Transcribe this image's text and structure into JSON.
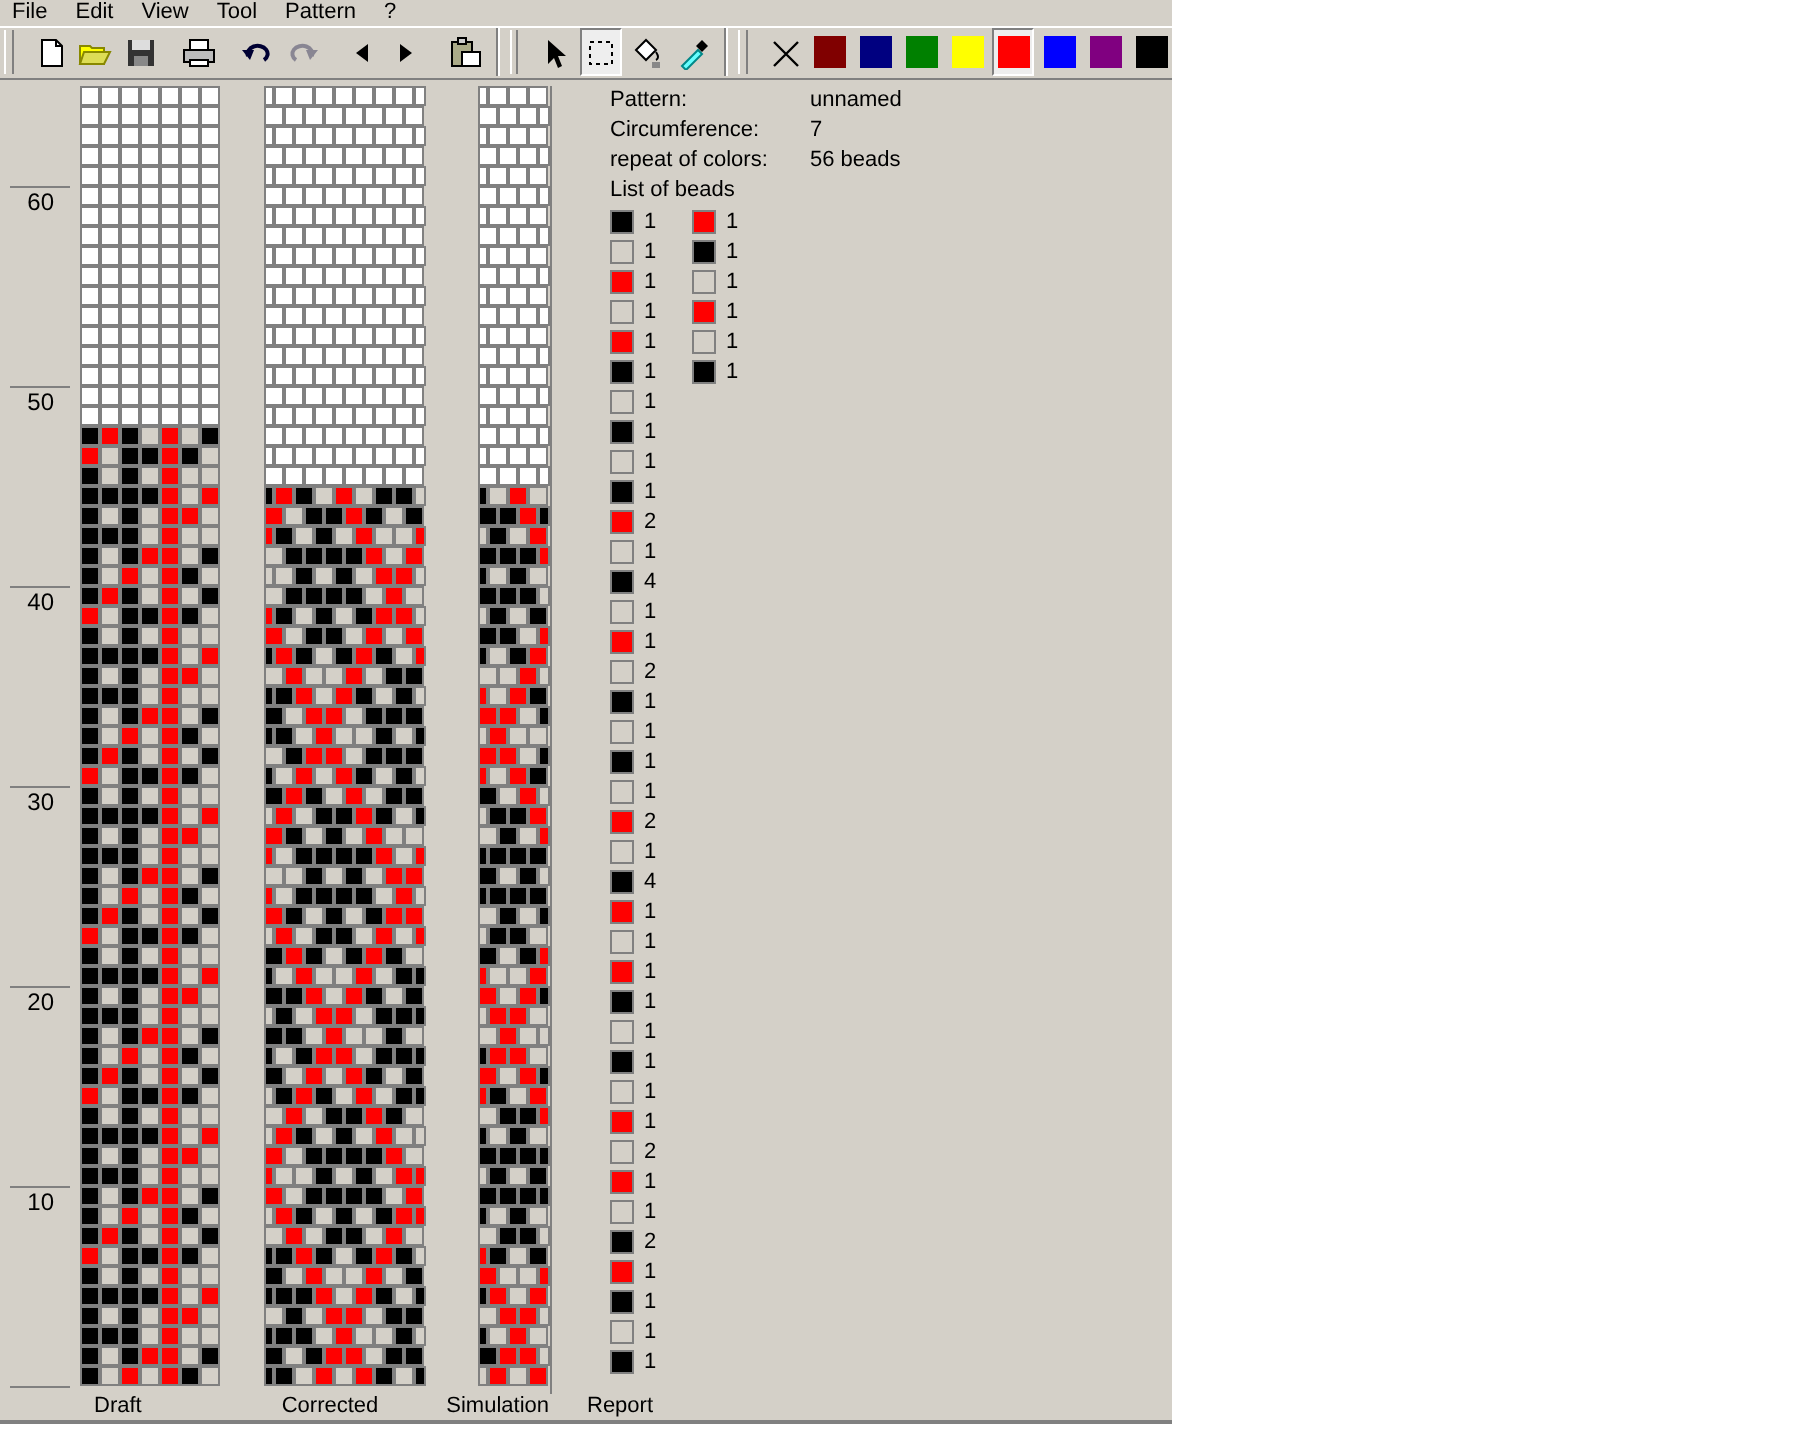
{
  "menu": [
    "File",
    "Edit",
    "View",
    "Tool",
    "Pattern",
    "?"
  ],
  "toolbar": {
    "file_buttons": [
      {
        "kind": "new",
        "disabled": false
      },
      {
        "kind": "open",
        "disabled": false
      },
      {
        "kind": "save",
        "disabled": false
      },
      {
        "kind": "print",
        "disabled": false
      },
      {
        "kind": "undo",
        "disabled": false
      },
      {
        "kind": "redo",
        "disabled": true
      },
      {
        "kind": "left",
        "disabled": false
      },
      {
        "kind": "right",
        "disabled": false
      },
      {
        "kind": "paste",
        "disabled": false
      }
    ],
    "tools": [
      {
        "kind": "pointer",
        "selected": false
      },
      {
        "kind": "select",
        "selected": true
      },
      {
        "kind": "fill",
        "selected": false
      },
      {
        "kind": "picker",
        "selected": false
      }
    ],
    "palette": [
      {
        "kind": "none",
        "selected": false
      },
      {
        "color": "#800000",
        "selected": false
      },
      {
        "color": "#000080",
        "selected": false
      },
      {
        "color": "#008000",
        "selected": false
      },
      {
        "color": "#ffff00",
        "selected": false
      },
      {
        "color": "#ff0000",
        "selected": true
      },
      {
        "color": "#0000ff",
        "selected": false
      },
      {
        "color": "#800080",
        "selected": false
      },
      {
        "color": "#000000",
        "selected": false
      }
    ]
  },
  "ruler": [
    "60",
    "50",
    "40",
    "30",
    "20",
    "10"
  ],
  "views": [
    "Draft",
    "Corrected",
    "Simulation",
    "Report"
  ],
  "report": {
    "rows": [
      {
        "label": "Pattern:",
        "value": "unnamed"
      },
      {
        "label": "Circumference:",
        "value": "7"
      },
      {
        "label": "repeat of colors:",
        "value": "56 beads"
      }
    ],
    "list_title": "List of beads",
    "bead_columns": [
      [
        {
          "color": "#000000",
          "count": "1"
        },
        {
          "color": "#d4d0c8",
          "count": "1"
        },
        {
          "color": "#ff0000",
          "count": "1"
        },
        {
          "color": "#d4d0c8",
          "count": "1"
        },
        {
          "color": "#ff0000",
          "count": "1"
        },
        {
          "color": "#000000",
          "count": "1"
        },
        {
          "color": "#d4d0c8",
          "count": "1"
        },
        {
          "color": "#000000",
          "count": "1"
        },
        {
          "color": "#d4d0c8",
          "count": "1"
        },
        {
          "color": "#000000",
          "count": "1"
        },
        {
          "color": "#ff0000",
          "count": "2"
        },
        {
          "color": "#d4d0c8",
          "count": "1"
        },
        {
          "color": "#000000",
          "count": "4"
        },
        {
          "color": "#d4d0c8",
          "count": "1"
        },
        {
          "color": "#ff0000",
          "count": "1"
        },
        {
          "color": "#d4d0c8",
          "count": "2"
        },
        {
          "color": "#000000",
          "count": "1"
        },
        {
          "color": "#d4d0c8",
          "count": "1"
        },
        {
          "color": "#000000",
          "count": "1"
        },
        {
          "color": "#d4d0c8",
          "count": "1"
        },
        {
          "color": "#ff0000",
          "count": "2"
        },
        {
          "color": "#d4d0c8",
          "count": "1"
        },
        {
          "color": "#000000",
          "count": "4"
        },
        {
          "color": "#ff0000",
          "count": "1"
        },
        {
          "color": "#d4d0c8",
          "count": "1"
        },
        {
          "color": "#ff0000",
          "count": "1"
        },
        {
          "color": "#000000",
          "count": "1"
        },
        {
          "color": "#d4d0c8",
          "count": "1"
        },
        {
          "color": "#000000",
          "count": "1"
        },
        {
          "color": "#d4d0c8",
          "count": "1"
        },
        {
          "color": "#ff0000",
          "count": "1"
        },
        {
          "color": "#d4d0c8",
          "count": "2"
        },
        {
          "color": "#ff0000",
          "count": "1"
        },
        {
          "color": "#d4d0c8",
          "count": "1"
        },
        {
          "color": "#000000",
          "count": "2"
        },
        {
          "color": "#ff0000",
          "count": "1"
        },
        {
          "color": "#000000",
          "count": "1"
        },
        {
          "color": "#d4d0c8",
          "count": "1"
        },
        {
          "color": "#000000",
          "count": "1"
        }
      ],
      [
        {
          "color": "#ff0000",
          "count": "1"
        },
        {
          "color": "#000000",
          "count": "1"
        },
        {
          "color": "#d4d0c8",
          "count": "1"
        },
        {
          "color": "#ff0000",
          "count": "1"
        },
        {
          "color": "#d4d0c8",
          "count": "1"
        },
        {
          "color": "#000000",
          "count": "1"
        }
      ]
    ]
  }
}
